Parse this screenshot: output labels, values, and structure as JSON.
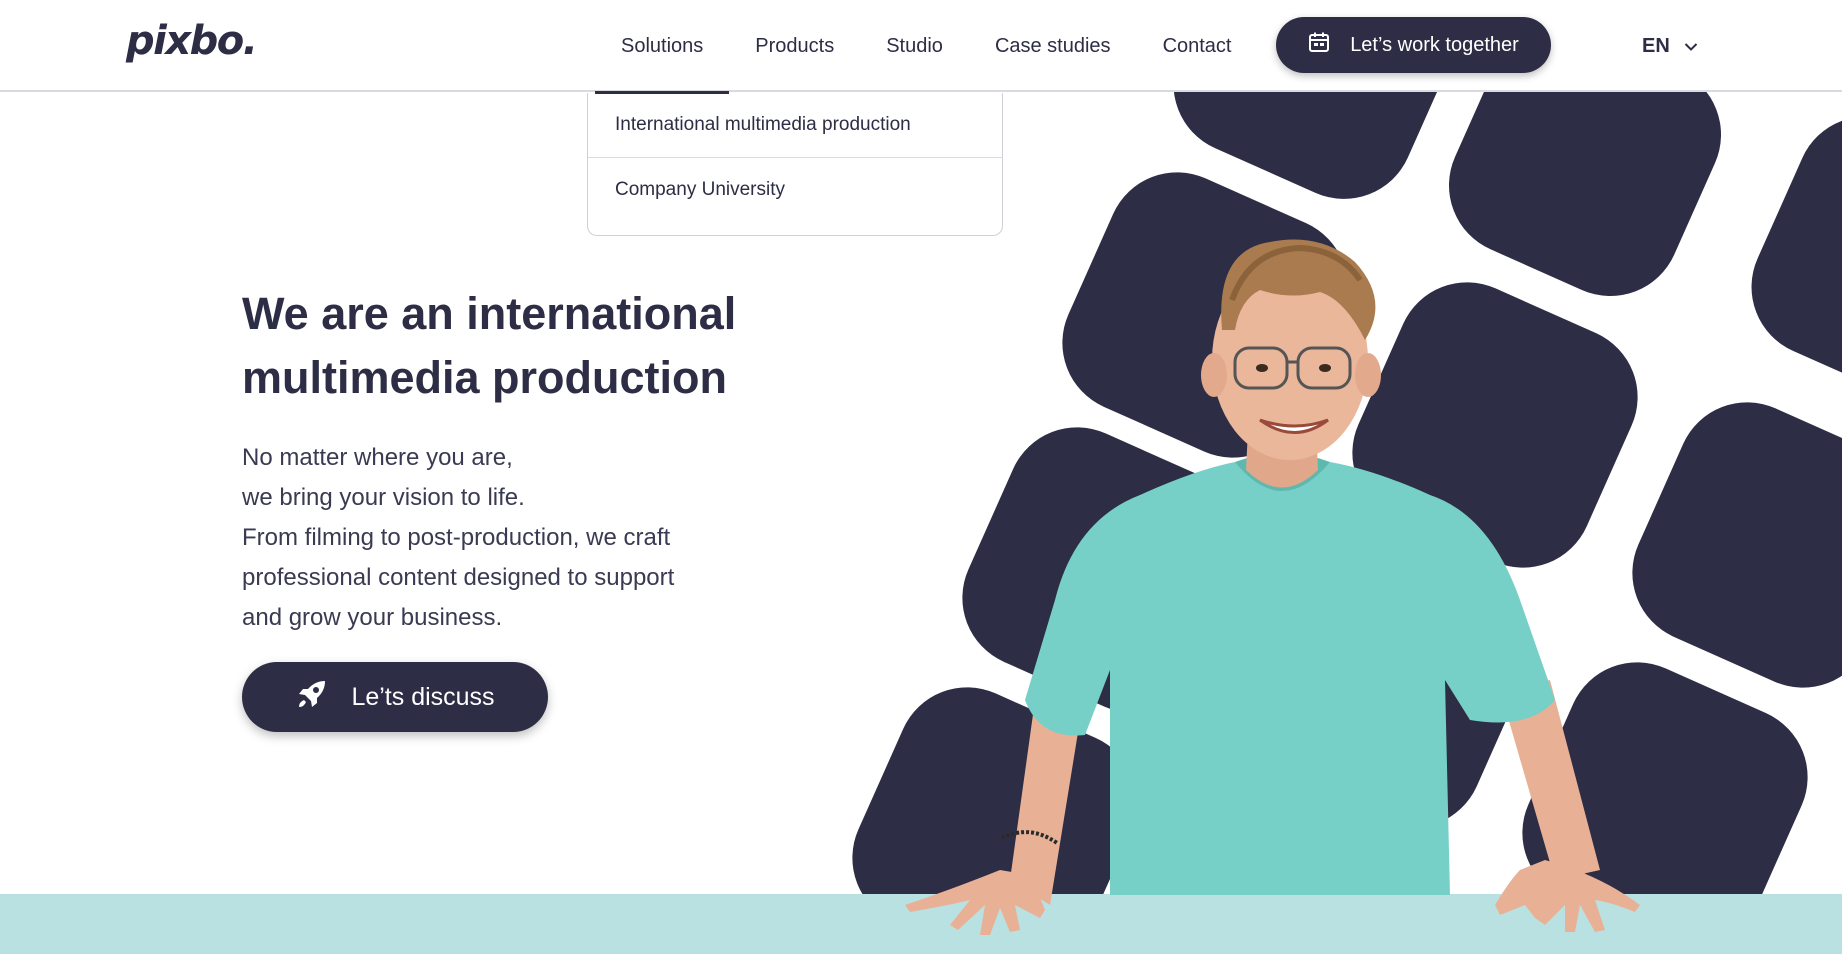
{
  "header": {
    "logo": "pixbo.",
    "nav": [
      {
        "label": "Solutions",
        "active": true
      },
      {
        "label": "Products"
      },
      {
        "label": "Studio"
      },
      {
        "label": "Case studies"
      },
      {
        "label": "Contact"
      }
    ],
    "cta_label": "Let’s work together",
    "cta_icon": "calendar-icon",
    "language": "EN",
    "language_icon": "chevron-down-icon"
  },
  "dropdown": {
    "items": [
      "International multimedia production",
      "Company University"
    ]
  },
  "hero": {
    "title_line1": "We are an international",
    "title_line2": "multimedia production",
    "paragraph": [
      "No matter where you are,",
      "we bring your vision to life.",
      "From filming to post-production, we craft",
      "professional content designed to support",
      "and grow your business."
    ],
    "button_label": "Le’ts discuss",
    "button_icon": "rocket-icon"
  },
  "colors": {
    "primary": "#2d2d45",
    "sweater": "#77d0c7",
    "floor": "#b9e1e2",
    "background": "#ffffff"
  }
}
